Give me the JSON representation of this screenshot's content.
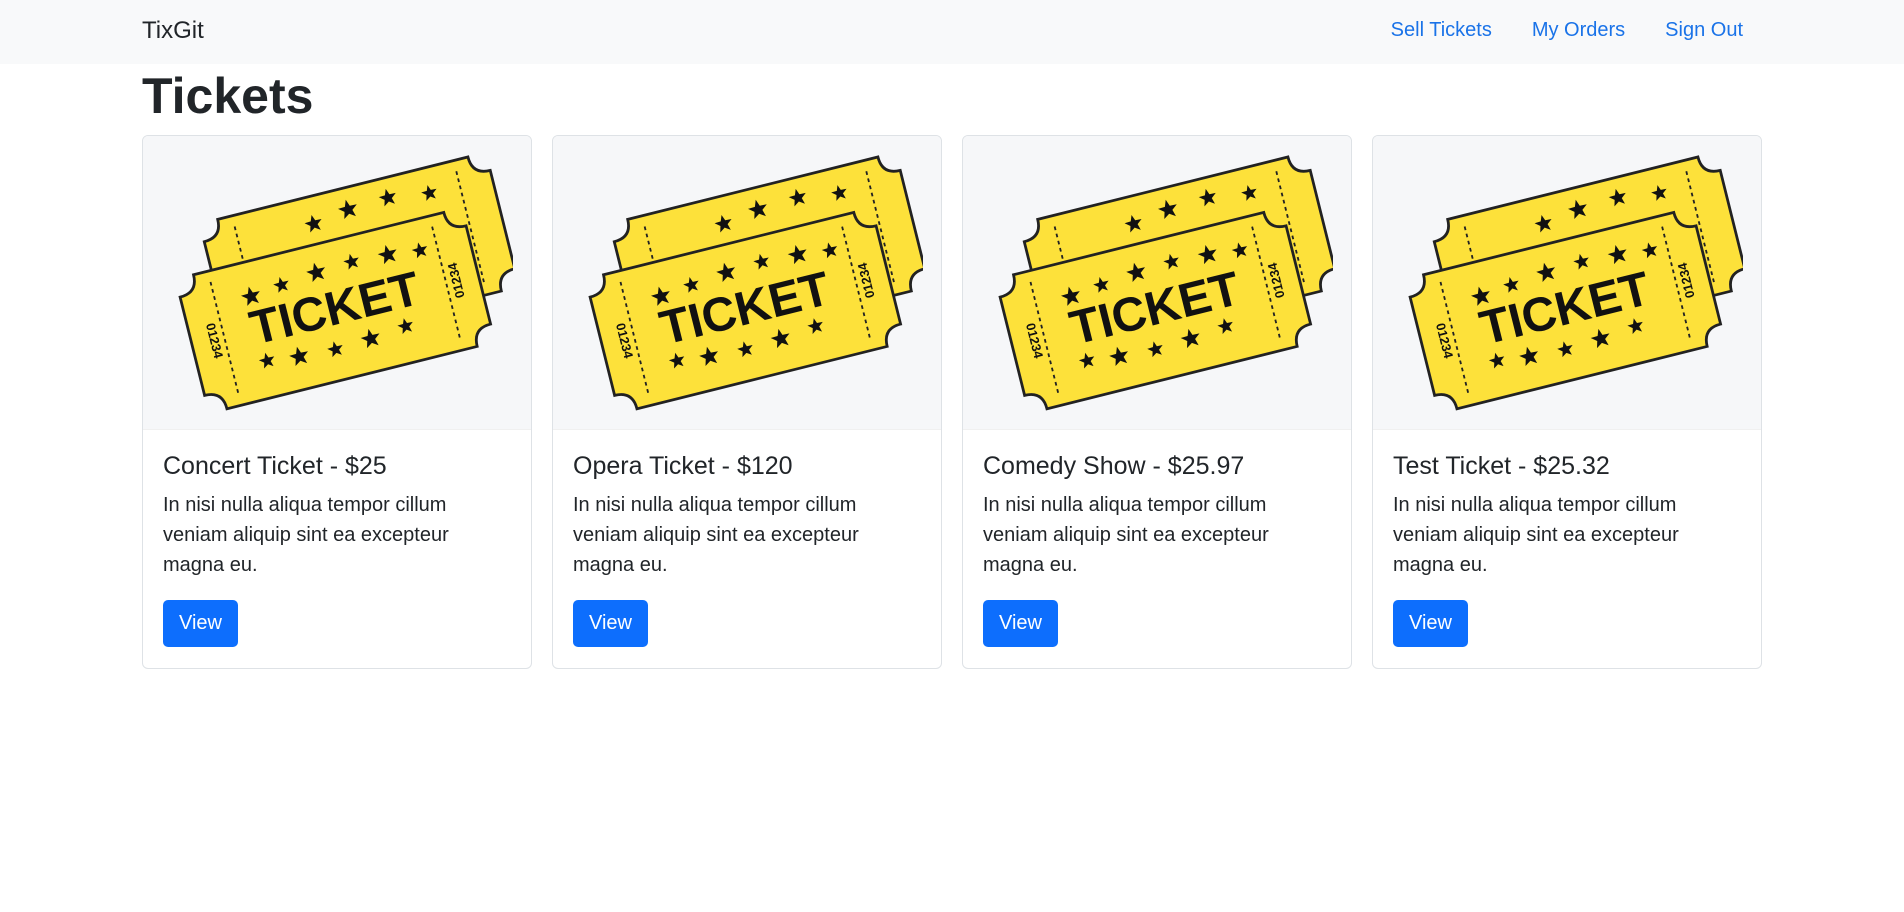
{
  "navbar": {
    "brand": "TixGit",
    "links": [
      "Sell Tickets",
      "My Orders",
      "Sign Out"
    ],
    "link_color": "#1a73e8"
  },
  "page": {
    "title": "Tickets"
  },
  "tickets": [
    {
      "title": "Concert Ticket - $25",
      "text": "In nisi nulla aliqua tempor cillum veniam aliquip sint ea excepteur magna eu.",
      "button": "View"
    },
    {
      "title": "Opera Ticket - $120",
      "text": "In nisi nulla aliqua tempor cillum veniam aliquip sint ea excepteur magna eu.",
      "button": "View"
    },
    {
      "title": "Comedy Show - $25.97",
      "text": "In nisi nulla aliqua tempor cillum veniam aliquip sint ea excepteur magna eu.",
      "button": "View"
    },
    {
      "title": "Test Ticket - $25.32",
      "text": "In nisi nulla aliqua tempor cillum veniam aliquip sint ea excepteur magna eu.",
      "button": "View"
    }
  ],
  "ticket_image": {
    "label": "TICKET",
    "serial": "01234",
    "color": "#fde13a",
    "icon": "ticket-image"
  },
  "button_color": "#0d6efd"
}
